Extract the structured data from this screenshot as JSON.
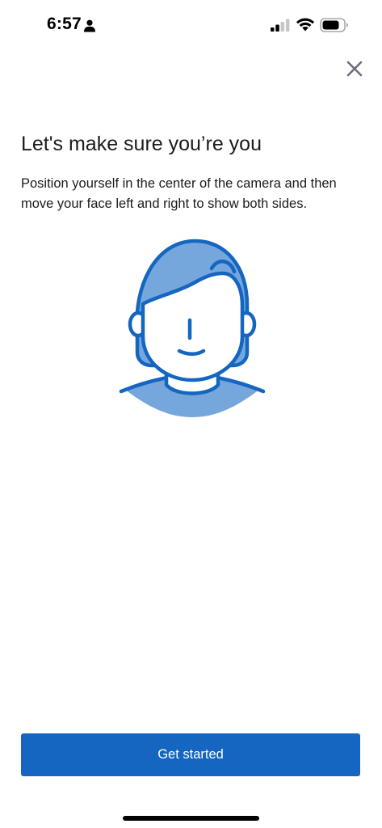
{
  "status_bar": {
    "time": "6:57",
    "icons": [
      "person-icon",
      "cellular-signal-icon",
      "wifi-icon",
      "battery-icon"
    ]
  },
  "header": {
    "close_icon": "close-icon"
  },
  "main": {
    "title": "Let's make sure you’re you",
    "description": "Position yourself in the center of the camera and then move your face left and right to show both sides.",
    "illustration_icon": "face-illustration"
  },
  "footer": {
    "primary_button_label": "Get started"
  },
  "colors": {
    "primary": "#1566c0",
    "illustration_fill": "#76a7dc",
    "illustration_stroke": "#1566c0",
    "close_icon": "#6b6f7b",
    "text": "#1b1b1b"
  }
}
